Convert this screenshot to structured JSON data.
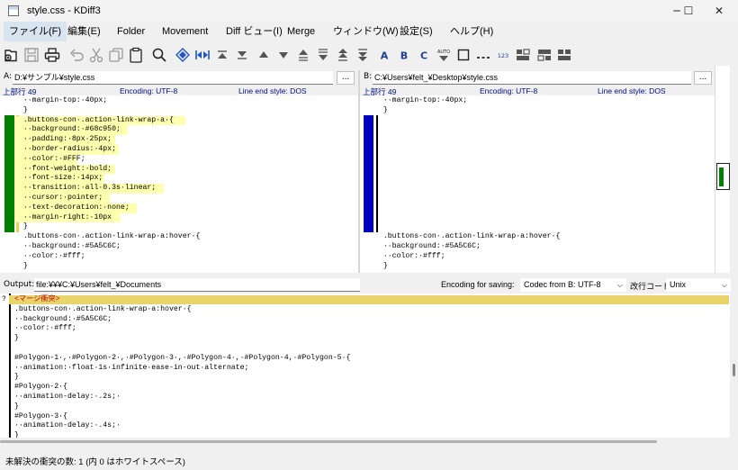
{
  "window": {
    "title": "style.css - KDiff3",
    "minimize": "─",
    "maximize": "☐",
    "close": "✕"
  },
  "menu": [
    {
      "label": "ファイル(F)"
    },
    {
      "label": "編集(E)"
    },
    {
      "label": "Folder"
    },
    {
      "label": "Movement"
    },
    {
      "label": "Diff ビュー(I)"
    },
    {
      "label": "Merge"
    },
    {
      "label": "ウィンドウ(W)"
    },
    {
      "label": "設定(S)"
    },
    {
      "label": "ヘルプ(H)"
    }
  ],
  "toolbar": {
    "text_buttons": {
      "a": "A",
      "b": "B",
      "c": "C",
      "auto": "AUTO",
      "num": "123"
    },
    "icons": [
      "open-icon",
      "save-icon",
      "print-icon",
      "undo-icon",
      "cut-icon",
      "copy-icon",
      "paste-icon",
      "search-icon",
      "go-current-icon",
      "go-conflict-icon",
      "go-top-icon",
      "go-bottom-icon",
      "go-prev-delta-icon",
      "go-next-delta-icon",
      "go-prev-conflict-icon",
      "go-next-conflict-icon",
      "go-prev-unsolved-icon",
      "go-next-unsolved-icon",
      "select-a-icon",
      "select-b-icon",
      "select-c-icon",
      "auto-advance-icon",
      "show-whitespace-icon",
      "show-whitespace-chars-icon",
      "line-numbers-icon",
      "split-view-icon",
      "window-a-icon",
      "window-b-icon"
    ]
  },
  "pane_a": {
    "label": "A:",
    "path": "D:¥サンプル¥style.css",
    "browse": "...",
    "info_line": "上部行 49",
    "encoding": "Encoding: UTF-8",
    "line_end": "Line end style: DOS",
    "lines": [
      "  ··margin-top:·40px;",
      "  }",
      "  .buttons-con·.action-link-wrap·a·{",
      "  ··background:·#68c950;",
      "  ··padding:·8px·25px;",
      "  ··border-radius:·4px;",
      "  ··color:·#FFF;",
      "  ··font-weight:·bold;",
      "  ··font-size:·14px;",
      "  ··transition:·all·0.3s·linear;",
      "  ··cursor:·pointer;",
      "  ··text-decoration:·none;",
      "  ··margin-right:·10px",
      "  }",
      "  .buttons-con·.action-link-wrap·a:hover·{",
      "  ··background:·#5A5C6C;",
      "  ··color:·#fff;",
      "  }"
    ]
  },
  "pane_b": {
    "label": "B:",
    "path": "C:¥Users¥felt_¥Desktop¥style.css",
    "browse": "...",
    "info_line": "上部行 49",
    "encoding": "Encoding: UTF-8",
    "line_end": "Line end style: DOS",
    "lines": [
      "  ··margin-top:·40px;",
      "  }",
      "  .buttons-con·.action-link-wrap·a:hover·{",
      "  ··background:·#5A5C6C;",
      "  ··color:·#fff;",
      "  }"
    ]
  },
  "output": {
    "label": "Output:",
    "path": "file:¥¥¥C:¥Users¥felt_¥Documents",
    "encoding_label": "Encoding for saving:",
    "encoding_value": "Codec from B: UTF-8",
    "eol_label": "改行コード:",
    "eol_value": "Unix",
    "conflict_marker": "?",
    "conflict_text": "<マージ衝突>",
    "lines": [
      ".buttons-con·.action-link-wrap·a:hover·{",
      "··background:·#5A5C6C;",
      "··color:·#fff;",
      "}",
      "",
      "#Polygon-1·,·#Polygon-2·,·#Polygon-3·,·#Polygon-4·,·#Polygon-4,·#Polygon-5·{",
      "··animation:·float·1s·infinite·ease-in-out·alternate;",
      "}",
      "#Polygon-2·{",
      "··animation-delay:·.2s;·",
      "}",
      "#Polygon-3·{",
      "··animation-delay:·.4s;·",
      "}"
    ]
  },
  "status": {
    "text": "未解決の衝突の数: 1 (内 0 はホワイトスペース)"
  },
  "colors": {
    "pane_a_marker": "#008000",
    "pane_b_marker": "#0000c0",
    "changed_highlight": "#ffffb0",
    "conflict_bar": "#e8d46a",
    "info_text": "#001080"
  }
}
